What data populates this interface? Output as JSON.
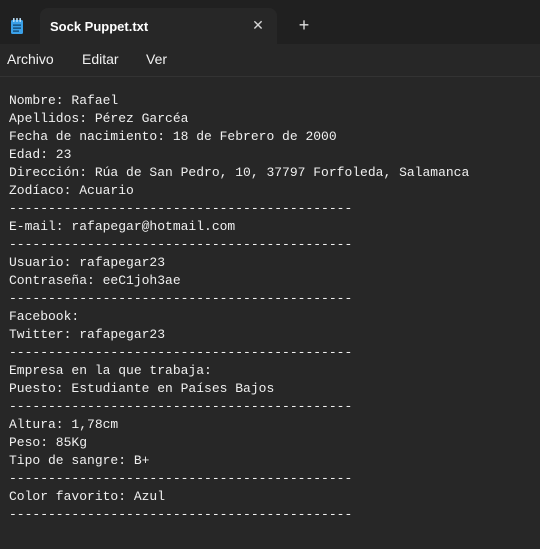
{
  "tab": {
    "title": "Sock Puppet.txt",
    "close_glyph": "✕",
    "new_tab_glyph": "+"
  },
  "app_icon": "notepad-icon",
  "menu": {
    "file": "Archivo",
    "edit": "Editar",
    "view": "Ver"
  },
  "document": {
    "content": "Nombre: Rafael\nApellidos: Pérez Garcéa\nFecha de nacimiento: 18 de Febrero de 2000\nEdad: 23\nDirección: Rúa de San Pedro, 10, 37797 Forfoleda, Salamanca\nZodíaco: Acuario\n--------------------------------------------\nE-mail: rafapegar@hotmail.com\n--------------------------------------------\nUsuario: rafapegar23\nContraseña: eeC1joh3ae\n--------------------------------------------\nFacebook:\nTwitter: rafapegar23\n--------------------------------------------\nEmpresa en la que trabaja:\nPuesto: Estudiante en Países Bajos\n--------------------------------------------\nAltura: 1,78cm\nPeso: 85Kg\nTipo de sangre: B+\n--------------------------------------------\nColor favorito: Azul\n--------------------------------------------"
  },
  "colors": {
    "background": "#272727",
    "titlebar": "#202020",
    "text": "#f0f0f0",
    "icon_accent": "#3aa0e8"
  }
}
